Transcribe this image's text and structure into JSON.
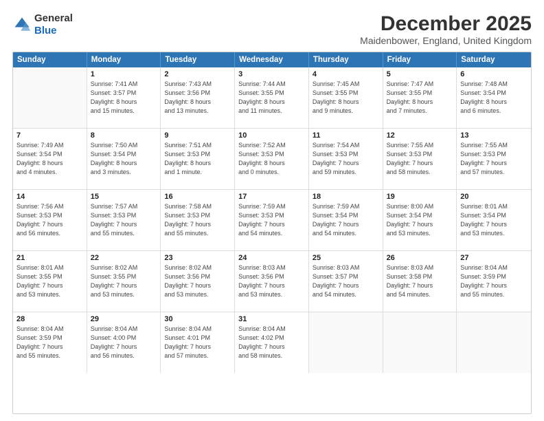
{
  "logo": {
    "general": "General",
    "blue": "Blue"
  },
  "title": "December 2025",
  "subtitle": "Maidenbower, England, United Kingdom",
  "days": [
    "Sunday",
    "Monday",
    "Tuesday",
    "Wednesday",
    "Thursday",
    "Friday",
    "Saturday"
  ],
  "rows": [
    [
      {
        "num": "",
        "info": ""
      },
      {
        "num": "1",
        "info": "Sunrise: 7:41 AM\nSunset: 3:57 PM\nDaylight: 8 hours\nand 15 minutes."
      },
      {
        "num": "2",
        "info": "Sunrise: 7:43 AM\nSunset: 3:56 PM\nDaylight: 8 hours\nand 13 minutes."
      },
      {
        "num": "3",
        "info": "Sunrise: 7:44 AM\nSunset: 3:55 PM\nDaylight: 8 hours\nand 11 minutes."
      },
      {
        "num": "4",
        "info": "Sunrise: 7:45 AM\nSunset: 3:55 PM\nDaylight: 8 hours\nand 9 minutes."
      },
      {
        "num": "5",
        "info": "Sunrise: 7:47 AM\nSunset: 3:55 PM\nDaylight: 8 hours\nand 7 minutes."
      },
      {
        "num": "6",
        "info": "Sunrise: 7:48 AM\nSunset: 3:54 PM\nDaylight: 8 hours\nand 6 minutes."
      }
    ],
    [
      {
        "num": "7",
        "info": "Sunrise: 7:49 AM\nSunset: 3:54 PM\nDaylight: 8 hours\nand 4 minutes."
      },
      {
        "num": "8",
        "info": "Sunrise: 7:50 AM\nSunset: 3:54 PM\nDaylight: 8 hours\nand 3 minutes."
      },
      {
        "num": "9",
        "info": "Sunrise: 7:51 AM\nSunset: 3:53 PM\nDaylight: 8 hours\nand 1 minute."
      },
      {
        "num": "10",
        "info": "Sunrise: 7:52 AM\nSunset: 3:53 PM\nDaylight: 8 hours\nand 0 minutes."
      },
      {
        "num": "11",
        "info": "Sunrise: 7:54 AM\nSunset: 3:53 PM\nDaylight: 7 hours\nand 59 minutes."
      },
      {
        "num": "12",
        "info": "Sunrise: 7:55 AM\nSunset: 3:53 PM\nDaylight: 7 hours\nand 58 minutes."
      },
      {
        "num": "13",
        "info": "Sunrise: 7:55 AM\nSunset: 3:53 PM\nDaylight: 7 hours\nand 57 minutes."
      }
    ],
    [
      {
        "num": "14",
        "info": "Sunrise: 7:56 AM\nSunset: 3:53 PM\nDaylight: 7 hours\nand 56 minutes."
      },
      {
        "num": "15",
        "info": "Sunrise: 7:57 AM\nSunset: 3:53 PM\nDaylight: 7 hours\nand 55 minutes."
      },
      {
        "num": "16",
        "info": "Sunrise: 7:58 AM\nSunset: 3:53 PM\nDaylight: 7 hours\nand 55 minutes."
      },
      {
        "num": "17",
        "info": "Sunrise: 7:59 AM\nSunset: 3:53 PM\nDaylight: 7 hours\nand 54 minutes."
      },
      {
        "num": "18",
        "info": "Sunrise: 7:59 AM\nSunset: 3:54 PM\nDaylight: 7 hours\nand 54 minutes."
      },
      {
        "num": "19",
        "info": "Sunrise: 8:00 AM\nSunset: 3:54 PM\nDaylight: 7 hours\nand 53 minutes."
      },
      {
        "num": "20",
        "info": "Sunrise: 8:01 AM\nSunset: 3:54 PM\nDaylight: 7 hours\nand 53 minutes."
      }
    ],
    [
      {
        "num": "21",
        "info": "Sunrise: 8:01 AM\nSunset: 3:55 PM\nDaylight: 7 hours\nand 53 minutes."
      },
      {
        "num": "22",
        "info": "Sunrise: 8:02 AM\nSunset: 3:55 PM\nDaylight: 7 hours\nand 53 minutes."
      },
      {
        "num": "23",
        "info": "Sunrise: 8:02 AM\nSunset: 3:56 PM\nDaylight: 7 hours\nand 53 minutes."
      },
      {
        "num": "24",
        "info": "Sunrise: 8:03 AM\nSunset: 3:56 PM\nDaylight: 7 hours\nand 53 minutes."
      },
      {
        "num": "25",
        "info": "Sunrise: 8:03 AM\nSunset: 3:57 PM\nDaylight: 7 hours\nand 54 minutes."
      },
      {
        "num": "26",
        "info": "Sunrise: 8:03 AM\nSunset: 3:58 PM\nDaylight: 7 hours\nand 54 minutes."
      },
      {
        "num": "27",
        "info": "Sunrise: 8:04 AM\nSunset: 3:59 PM\nDaylight: 7 hours\nand 55 minutes."
      }
    ],
    [
      {
        "num": "28",
        "info": "Sunrise: 8:04 AM\nSunset: 3:59 PM\nDaylight: 7 hours\nand 55 minutes."
      },
      {
        "num": "29",
        "info": "Sunrise: 8:04 AM\nSunset: 4:00 PM\nDaylight: 7 hours\nand 56 minutes."
      },
      {
        "num": "30",
        "info": "Sunrise: 8:04 AM\nSunset: 4:01 PM\nDaylight: 7 hours\nand 57 minutes."
      },
      {
        "num": "31",
        "info": "Sunrise: 8:04 AM\nSunset: 4:02 PM\nDaylight: 7 hours\nand 58 minutes."
      },
      {
        "num": "",
        "info": ""
      },
      {
        "num": "",
        "info": ""
      },
      {
        "num": "",
        "info": ""
      }
    ]
  ]
}
